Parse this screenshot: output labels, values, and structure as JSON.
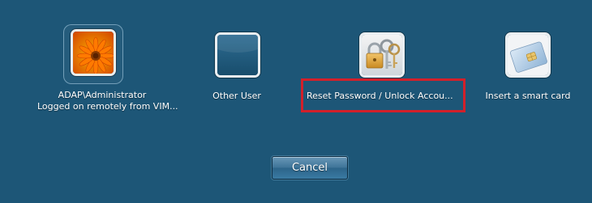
{
  "tiles": {
    "administrator": {
      "name": "ADAP\\Administrator",
      "status": "Logged on remotely from VIM..."
    },
    "other_user": {
      "label": "Other User"
    },
    "reset_password": {
      "label": "Reset Password / Unlock Accou..."
    },
    "smart_card": {
      "label": "Insert a smart card"
    }
  },
  "icons": {
    "administrator": "flower-avatar-icon",
    "other_user": "blank-user-icon",
    "reset_password": "keys-padlock-icon",
    "smart_card": "smart-card-icon"
  },
  "cancel_label": "Cancel",
  "colors": {
    "background": "#1d5677",
    "highlight": "#d2202a"
  }
}
